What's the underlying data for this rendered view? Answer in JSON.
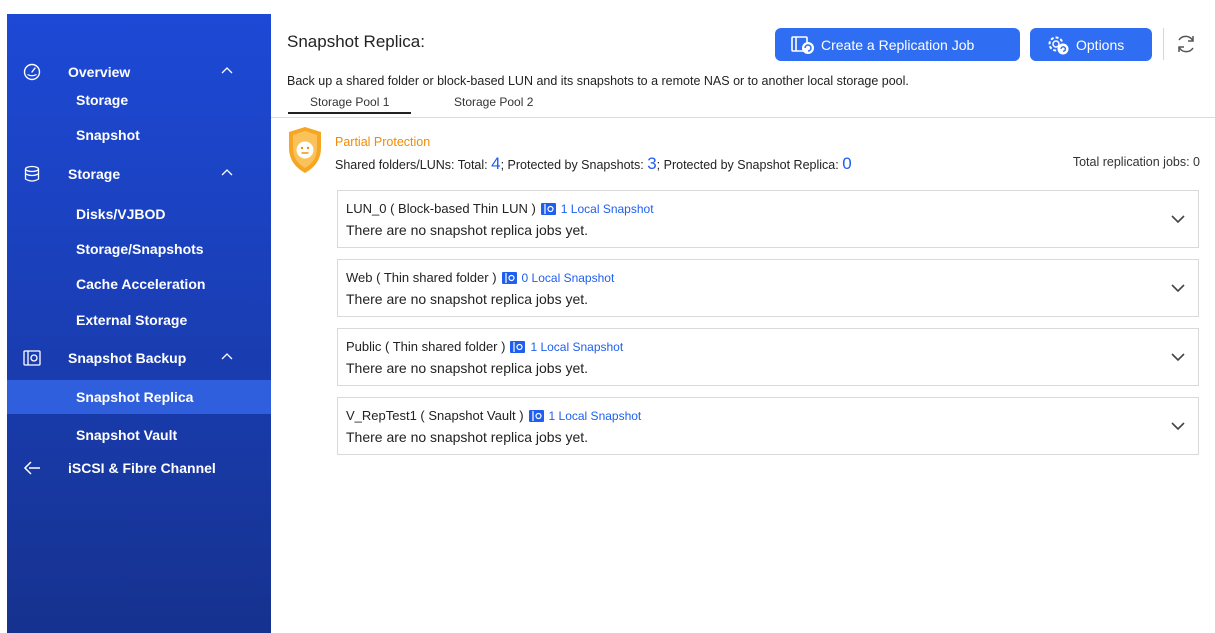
{
  "sidebar": {
    "groups": [
      {
        "label": "Overview",
        "icon": "gauge-icon"
      },
      {
        "label": "Storage",
        "icon": "database-icon"
      },
      {
        "label": "Snapshot Backup",
        "icon": "snapshot-icon"
      },
      {
        "label": "iSCSI & Fibre Channel",
        "icon": "iscsi-icon"
      }
    ],
    "items": [
      {
        "label": "Storage"
      },
      {
        "label": "Snapshot"
      },
      {
        "label": "Disks/VJBOD"
      },
      {
        "label": "Storage/Snapshots"
      },
      {
        "label": "Cache Acceleration"
      },
      {
        "label": "External Storage"
      },
      {
        "label": "Snapshot Replica"
      },
      {
        "label": "Snapshot Vault"
      }
    ],
    "active_item": "Snapshot Replica"
  },
  "header": {
    "title": "Snapshot Replica:",
    "create_button": "Create a Replication Job",
    "options_button": "Options",
    "description": "Back up a shared folder or block-based LUN and its snapshots to a remote NAS or to another local storage pool."
  },
  "tabs": [
    {
      "label": "Storage Pool 1",
      "active": true
    },
    {
      "label": "Storage Pool 2",
      "active": false
    }
  ],
  "protection": {
    "status": "Partial Protection",
    "prefix_total": "Shared folders/LUNs: Total: ",
    "total": "4",
    "prefix_protected": "; Protected by Snapshots: ",
    "protected": "3",
    "prefix_replica": "; Protected by Snapshot Replica: ",
    "replica": "0",
    "total_jobs": "Total replication jobs: 0"
  },
  "cards": [
    {
      "name": "LUN_0 ( Block-based Thin LUN )",
      "snapshots": "1 Local Snapshot",
      "message": "There are no snapshot replica jobs yet."
    },
    {
      "name": "Web ( Thin shared folder )",
      "snapshots": "0 Local Snapshot",
      "message": "There are no snapshot replica jobs yet."
    },
    {
      "name": "Public ( Thin shared folder )",
      "snapshots": "1 Local Snapshot",
      "message": "There are no snapshot replica jobs yet."
    },
    {
      "name": "V_RepTest1 ( Snapshot Vault )",
      "snapshots": "1 Local Snapshot",
      "message": "There are no snapshot replica jobs yet."
    }
  ],
  "colors": {
    "sidebar": "#1d49d6",
    "sidebar_active": "#2f5fdc",
    "primary_button": "#2f6df2",
    "link": "#1e5ff0",
    "warning": "#f08c00"
  }
}
